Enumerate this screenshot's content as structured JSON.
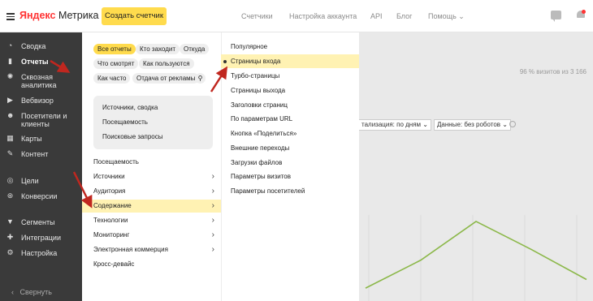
{
  "header": {
    "logo_brand": "Яндекс",
    "logo_product": "Метрика",
    "create_button": "Создать счетчик",
    "nav": [
      {
        "label": "Счетчики"
      },
      {
        "label": "Настройка аккаунта"
      },
      {
        "label": "API"
      },
      {
        "label": "Блог"
      },
      {
        "label": "Помощь"
      }
    ]
  },
  "sidebar": {
    "items": [
      {
        "label": "Сводка",
        "icon": "dashboard-icon"
      },
      {
        "label": "Отчеты",
        "icon": "bar-chart-icon",
        "active": true
      },
      {
        "label": "Сквозная аналитика",
        "icon": "end-to-end-analytics-icon"
      },
      {
        "label": "Вебвизор",
        "icon": "play-icon"
      },
      {
        "label": "Посетители и клиенты",
        "icon": "people-icon"
      },
      {
        "label": "Карты",
        "icon": "map-icon"
      },
      {
        "label": "Контент",
        "icon": "pen-icon"
      },
      {
        "label": "Цели",
        "icon": "target-icon"
      },
      {
        "label": "Конверсии",
        "icon": "conversion-icon"
      },
      {
        "label": "Сегменты",
        "icon": "filter-icon"
      },
      {
        "label": "Интеграции",
        "icon": "puzzle-icon"
      },
      {
        "label": "Настройка",
        "icon": "gear-icon"
      }
    ],
    "collapse_label": "Свернуть"
  },
  "reports": {
    "chips": [
      {
        "label": "Все отчеты",
        "selected": true
      },
      {
        "label": "Кто заходит"
      },
      {
        "label": "Откуда"
      },
      {
        "label": "Что смотрят"
      },
      {
        "label": "Как пользуются"
      },
      {
        "label": "Как часто"
      },
      {
        "label": "Отдача от рекламы"
      }
    ],
    "card_links": [
      {
        "label": "Источники, сводка"
      },
      {
        "label": "Посещаемость"
      },
      {
        "label": "Поисковые запросы"
      }
    ],
    "categories": [
      {
        "label": "Посещаемость",
        "has_submenu": false
      },
      {
        "label": "Источники",
        "has_submenu": true
      },
      {
        "label": "Аудитория",
        "has_submenu": true
      },
      {
        "label": "Содержание",
        "has_submenu": true,
        "highlighted": true
      },
      {
        "label": "Технологии",
        "has_submenu": true
      },
      {
        "label": "Мониторинг",
        "has_submenu": true
      },
      {
        "label": "Электронная коммерция",
        "has_submenu": true
      },
      {
        "label": "Кросс-девайс",
        "has_submenu": false
      }
    ]
  },
  "submenu": {
    "items": [
      {
        "label": "Популярное"
      },
      {
        "label": "Страницы входа",
        "highlighted": true
      },
      {
        "label": "Турбо-страницы"
      },
      {
        "label": "Страницы выхода"
      },
      {
        "label": "Заголовки страниц"
      },
      {
        "label": "По параметрам URL"
      },
      {
        "label": "Кнопка «Поделиться»"
      },
      {
        "label": "Внешние переходы"
      },
      {
        "label": "Загрузки файлов"
      },
      {
        "label": "Параметры визитов"
      },
      {
        "label": "Параметры посетителей"
      }
    ]
  },
  "background": {
    "visits_text": "96 % визитов из 3 166",
    "detail_dropdown": "тализация: по дням",
    "data_dropdown": "Данные: без роботов"
  },
  "chart_data": {
    "type": "line",
    "color": "#8cb84a",
    "values": [
      12,
      38,
      74,
      48,
      20
    ]
  },
  "colors": {
    "accent": "#ffdb4d",
    "highlight": "#fff2b3",
    "sidebar": "#3a3a3a",
    "annotation_arrow": "#c0271f"
  }
}
